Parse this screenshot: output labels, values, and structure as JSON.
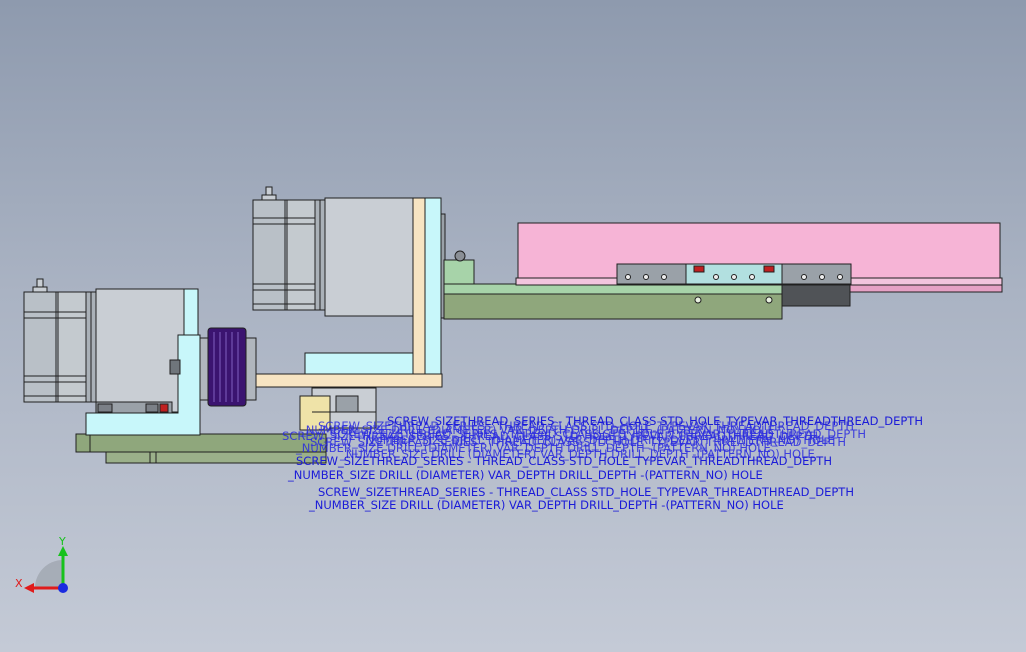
{
  "colors": {
    "motor_body": "#b9c0c7",
    "motor_face": "#c9ced4",
    "bracket_cyan": "#c8f7fa",
    "plate_green": "#8fa77c",
    "rail_green": "#a7d3a9",
    "carriage_pink": "#f6b4d6",
    "spring_purple": "#3b1470",
    "annotation_blue": "#1b1bd8",
    "outline": "#202020",
    "axis_x": "#e01b1b",
    "axis_y": "#17c21c",
    "axis_z": "#1b2be0"
  },
  "triad": {
    "x_label": "X",
    "y_label": "Y"
  },
  "annotations": {
    "hole_callout": [
      {
        "line1": "SCREW_SIZETHREAD_SERIES - THREAD_CLASS STD_HOLE_TYPEVAR_THREADTHREAD_DEPTH",
        "line2": "_NUMBER_SIZE DRILL (DIAMETER) VAR_DEPTH DRILL_DEPTH  -(PATTERN_NO) HOLE"
      },
      {
        "line1": "SCREW_SIZETHREAD_SERIES - THREAD_CLASS STD_HOLE_TYPEVAR_THREADTHREAD_DEPTH",
        "line2": "_NUMBER_SIZE DRILL (DIAMETER) VAR_DEPTH DRILL_DEPTH  -(PATTERN_NO) HOLE"
      },
      {
        "line1": "SCREW_SIZETHREAD_SERIES - THREAD_CLASS STD_HOLE_TYPEVAR_THREADTHREAD_DEPTH",
        "line2": "_NUMBER_SIZE DRILL (DIAMETER) VAR_DEPTH DRILL_DEPTH  -(PATTERN_NO) HOLE"
      }
    ]
  }
}
